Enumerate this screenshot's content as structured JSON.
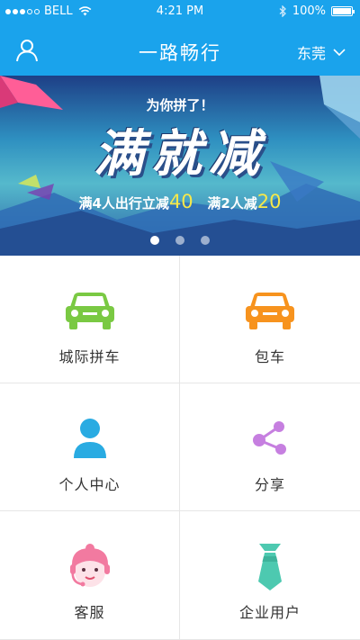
{
  "status_bar": {
    "carrier": "BELL",
    "time": "4:21 PM",
    "battery": "100%",
    "signal_bars_filled": 3,
    "signal_bars_total": 5,
    "battery_level": 1.0
  },
  "nav": {
    "title": "一路畅行",
    "city": "东莞"
  },
  "banner": {
    "subtitle": "为你拼了！",
    "headline": "满就减",
    "promo_part1": "满4人出行立减",
    "promo_num1": "40",
    "promo_part2": "满2人减",
    "promo_num2": "20",
    "page_count": 3,
    "active_page": 1
  },
  "menu": {
    "items": [
      {
        "label": "城际拼车",
        "icon": "car-icon",
        "color": "#7ac943"
      },
      {
        "label": "包车",
        "icon": "car-icon",
        "color": "#f7931e"
      },
      {
        "label": "个人中心",
        "icon": "person-icon",
        "color": "#29abe2"
      },
      {
        "label": "分享",
        "icon": "share-icon",
        "color": "#c67fe0"
      },
      {
        "label": "客服",
        "icon": "customer-service-icon",
        "color": "#f27aa0"
      },
      {
        "label": "企业用户",
        "icon": "tie-icon",
        "color": "#4dc9b0"
      }
    ]
  },
  "colors": {
    "header": "#1aa3ec",
    "promo_number": "#f6e84a"
  }
}
